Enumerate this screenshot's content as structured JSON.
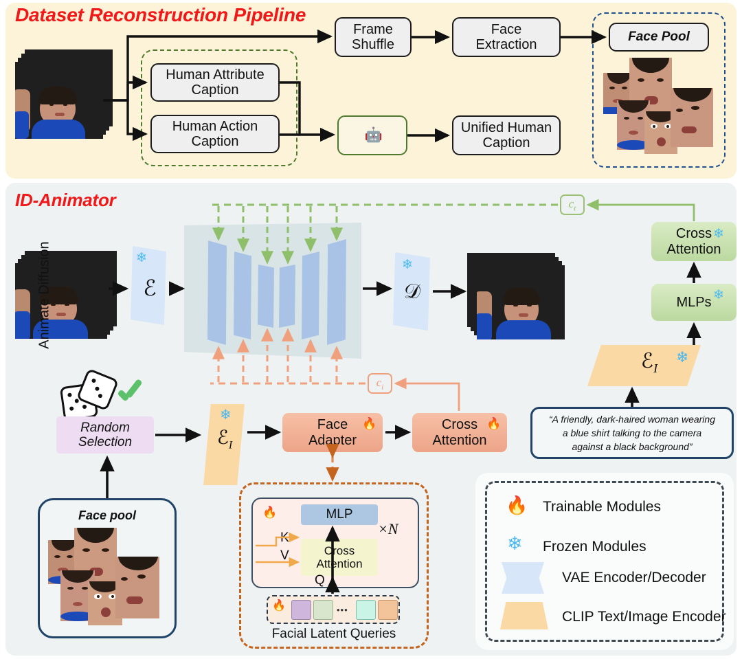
{
  "figure": {
    "top_panel": {
      "title": "Dataset Reconstruction Pipeline",
      "bg": "#fdf3d8",
      "title_color": "#f01818",
      "nodes": {
        "human_attribute_caption": "Human Attribute\nCaption",
        "human_attribute_caption_l1": "Human Attribute",
        "human_attribute_caption_l2": "Caption",
        "human_action_caption_l1": "Human Action",
        "human_action_caption_l2": "Caption",
        "frame_shuffle_l1": "Frame",
        "frame_shuffle_l2": "Shuffle",
        "face_extraction_l1": "Face",
        "face_extraction_l2": "Extraction",
        "llm": "LLM",
        "unified_human_caption_l1": "Unified Human",
        "unified_human_caption_l2": "Caption",
        "face_pool": "Face Pool"
      },
      "group_box_color": "#4f7a2e",
      "face_pool_box_color": "#20508c"
    },
    "bottom_panel": {
      "title": "ID-Animator",
      "bg": "#eef2f2",
      "title_color": "#f01818",
      "nodes": {
        "vae_encoder": "ℰ",
        "vae_decoder": "𝒟",
        "animate_diffusion": "Animate Diffusion",
        "cond_text": "c",
        "cond_text_sub": "t",
        "cond_image": "c",
        "cond_image_sub": "i",
        "cross_attention_text_l1": "Cross",
        "cross_attention_text_l2": "Attention",
        "mlps": "MLPs",
        "clip_text_encoder": "ℰ",
        "clip_text_encoder_sub": "I",
        "clip_image_encoder": "ℰ",
        "clip_image_encoder_sub": "I",
        "prompt_l1": "“A friendly, dark-haired woman wearing",
        "prompt_l2": "a blue shirt talking to the camera",
        "prompt_l3": "against a black background”",
        "random_selection_l1": "Random",
        "random_selection_l2": "Selection",
        "face_pool": "Face pool",
        "face_adapter_l1": "Face",
        "face_adapter_l2": "Adapter",
        "cross_attention_img_l1": "Cross",
        "cross_attention_img_l2": "Attention"
      },
      "adapter_detail": {
        "mlp": "MLP",
        "cross_attention_l1": "Cross",
        "cross_attention_l2": "Attention",
        "k_label": "K",
        "v_label": "V",
        "q_label": "Q",
        "repeat_label": "×N",
        "queries_label": "Facial Latent Queries",
        "ellipsis": "•••",
        "query_colors": [
          "#cfb6dd",
          "#d7e6cc",
          "#c9f4e6",
          "#f3c49a"
        ]
      }
    },
    "legend": {
      "items": [
        {
          "icon": "fire-icon",
          "label": "Trainable Modules"
        },
        {
          "icon": "snowflake-icon",
          "label": "Frozen Modules"
        },
        {
          "icon": "vae-shape",
          "label": "VAE Encoder/Decoder"
        },
        {
          "icon": "clip-shape",
          "label": "CLIP Text/Image Encoder"
        }
      ]
    },
    "colors": {
      "green_cond": "#8fbf6a",
      "orange_cond": "#f0a07c",
      "vae_blue": "#d7e6f8",
      "clip_orange": "#fbd9a5",
      "green_module": "#cfe3b4",
      "orange_module": "#f3b295",
      "purple_module": "#eedcf2",
      "unet_blue": "#a9c3e6",
      "dark_navy": "#20508c"
    }
  }
}
